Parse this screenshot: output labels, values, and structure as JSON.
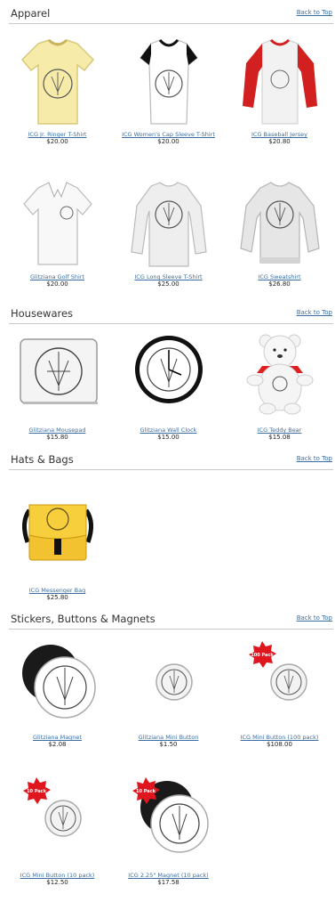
{
  "back_to_top": "Back to Top",
  "sections": [
    {
      "title": "Apparel",
      "products": [
        {
          "name": "ICG Jr. Ringer T-Shirt",
          "price": "$20.00"
        },
        {
          "name": "ICG Women's Cap Sleeve T-Shirt",
          "price": "$20.00"
        },
        {
          "name": "ICG Baseball Jersey",
          "price": "$20.80"
        },
        {
          "name": "Glitziana Golf Shirt",
          "price": "$20.00"
        },
        {
          "name": "ICG Long Sleeve T-Shirt",
          "price": "$25.00"
        },
        {
          "name": "ICG Sweatshirt",
          "price": "$26.80"
        }
      ]
    },
    {
      "title": "Housewares",
      "products": [
        {
          "name": "Glitziana Mousepad",
          "price": "$15.80"
        },
        {
          "name": "Glitziana Wall Clock",
          "price": "$15.00"
        },
        {
          "name": "ICG Teddy Bear",
          "price": "$15.08"
        }
      ]
    },
    {
      "title": "Hats & Bags",
      "products": [
        {
          "name": "ICG Messenger Bag",
          "price": "$25.80"
        }
      ]
    },
    {
      "title": "Stickers, Buttons & Magnets",
      "products": [
        {
          "name": "Glitziana Magnet",
          "price": "$2.08"
        },
        {
          "name": "Glitziana Mini Button",
          "price": "$1.50"
        },
        {
          "name": "ICG Mini Button (100 pack)",
          "price": "$108.00",
          "badge": "100 Pack"
        },
        {
          "name": "ICG Mini Button (10 pack)",
          "price": "$12.50",
          "badge": "10 Pack"
        },
        {
          "name": "ICG 2.25\" Magnet (10 pack)",
          "price": "$17.58",
          "badge": "10 Pack"
        }
      ]
    }
  ],
  "colors": {
    "link": "#3a6ea5",
    "rule": "#c9c9c9",
    "badge": "#e0161e",
    "jersey_red": "#d21f1f",
    "bag_yellow": "#f2c230",
    "ringer_yellow": "#f6eba8"
  }
}
